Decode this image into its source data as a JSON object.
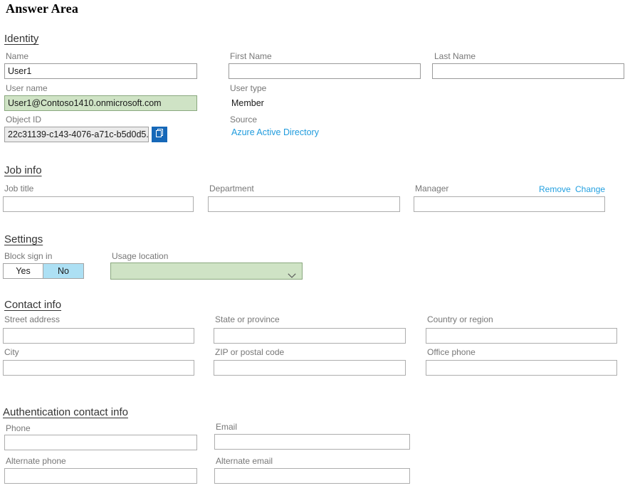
{
  "page": {
    "title": "Answer Area"
  },
  "sections": {
    "identity": {
      "heading": "Identity",
      "name": {
        "label": "Name",
        "value": "User1"
      },
      "first_name": {
        "label": "First Name",
        "value": ""
      },
      "last_name": {
        "label": "Last Name",
        "value": ""
      },
      "user_name": {
        "label": "User name",
        "value": "User1@Contoso1410.onmicrosoft.com"
      },
      "user_type": {
        "label": "User type",
        "value": "Member"
      },
      "object_id": {
        "label": "Object ID",
        "value": "22c31139-c143-4076-a71c-b5d0d5..."
      },
      "source": {
        "label": "Source",
        "value": "Azure Active Directory"
      },
      "copy_icon": "copy-icon"
    },
    "job_info": {
      "heading": "Job info",
      "job_title": {
        "label": "Job title",
        "value": ""
      },
      "department": {
        "label": "Department",
        "value": ""
      },
      "manager": {
        "label": "Manager",
        "value": ""
      },
      "manager_remove": "Remove",
      "manager_change": "Change"
    },
    "settings": {
      "heading": "Settings",
      "block_sign_in": {
        "label": "Block sign in",
        "options": [
          "Yes",
          "No"
        ],
        "selected": "No"
      },
      "usage_location": {
        "label": "Usage location",
        "value": "",
        "chevron_icon": "chevron-down-icon"
      }
    },
    "contact_info": {
      "heading": "Contact info",
      "street_address": {
        "label": "Street address",
        "value": ""
      },
      "state_or_province": {
        "label": "State or province",
        "value": ""
      },
      "country_or_region": {
        "label": "Country or region",
        "value": ""
      },
      "city": {
        "label": "City",
        "value": ""
      },
      "zip_or_postal_code": {
        "label": "ZIP or postal code",
        "value": ""
      },
      "office_phone": {
        "label": "Office phone",
        "value": ""
      }
    },
    "auth_contact_info": {
      "heading": "Authentication contact info",
      "phone": {
        "label": "Phone",
        "value": ""
      },
      "email": {
        "label": "Email",
        "value": ""
      },
      "alternate_phone": {
        "label": "Alternate phone",
        "value": ""
      },
      "alternate_email": {
        "label": "Alternate email",
        "value": ""
      }
    }
  },
  "colors": {
    "link": "#1f9bdd",
    "green_fill": "#cfe3c5",
    "green_border": "#8aa87f",
    "toggle_selected": "#ade0f4",
    "copy_button": "#1668b8",
    "readonly_fill": "#ebebeb",
    "label_text": "#777777"
  }
}
